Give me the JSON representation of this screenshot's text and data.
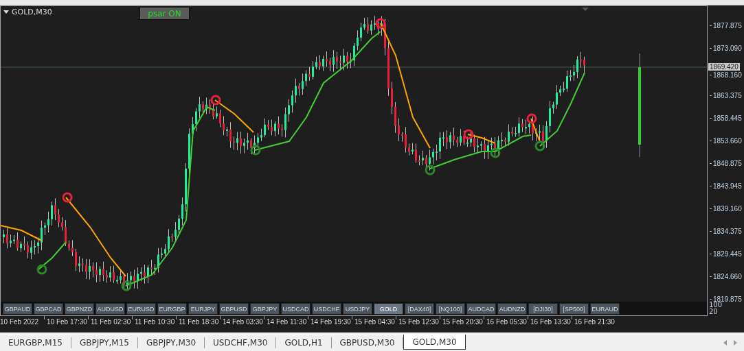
{
  "chart": {
    "title": "GOLD,M30",
    "indicator_button": "psar ON",
    "price_axis": [
      "1877.875",
      "1873.090",
      "1868.160",
      "1863.375",
      "1858.445",
      "1853.660",
      "1848.875",
      "1843.945",
      "1839.160",
      "1834.375",
      "1829.445",
      "1824.660",
      "1819.875"
    ],
    "current_price": "1869.420",
    "symbol_buttons": [
      {
        "label": "GBPAUD",
        "selected": false
      },
      {
        "label": "GBPCAD",
        "selected": false
      },
      {
        "label": "GBPNZD",
        "selected": false
      },
      {
        "label": "AUDUSD",
        "selected": false
      },
      {
        "label": "EURUSD",
        "selected": false
      },
      {
        "label": "EURGBP",
        "selected": false
      },
      {
        "label": "EURJPY",
        "selected": false
      },
      {
        "label": "GBPUSD",
        "selected": false
      },
      {
        "label": "GBPJPY",
        "selected": false
      },
      {
        "label": "USDCAD",
        "selected": false
      },
      {
        "label": "USDCHF",
        "selected": false
      },
      {
        "label": "USDJPY",
        "selected": false
      },
      {
        "label": "GOLD",
        "selected": true
      },
      {
        "label": "[DAX40]",
        "selected": false
      },
      {
        "label": "[NQ100]",
        "selected": false
      },
      {
        "label": "AUDCAD",
        "selected": false
      },
      {
        "label": "AUDNZD",
        "selected": false
      },
      {
        "label": "[DJI30]",
        "selected": false
      },
      {
        "label": "[SP500]",
        "selected": false
      },
      {
        "label": "EURAUD",
        "selected": false
      }
    ],
    "indicator_levels": [
      "100",
      "20"
    ],
    "time_axis": [
      "10 Feb 2022",
      "10 Feb 17:30",
      "11 Feb 02:30",
      "11 Feb 10:30",
      "11 Feb 18:30",
      "14 Feb 03:30",
      "14 Feb 11:30",
      "14 Feb 19:30",
      "15 Feb 04:30",
      "15 Feb 12:30",
      "15 Feb 20:30",
      "16 Feb 05:30",
      "16 Feb 13:30",
      "16 Feb 21:30"
    ]
  },
  "tabs": [
    {
      "label": "EURGBP,M15",
      "selected": false
    },
    {
      "label": "GBPJPY,M15",
      "selected": false
    },
    {
      "label": "GBPJPY,M30",
      "selected": false
    },
    {
      "label": "USDCHF,M30",
      "selected": false
    },
    {
      "label": "GOLD,H1",
      "selected": false
    },
    {
      "label": "GBPUSD,M30",
      "selected": false
    },
    {
      "label": "GOLD,M30",
      "selected": true
    }
  ]
}
